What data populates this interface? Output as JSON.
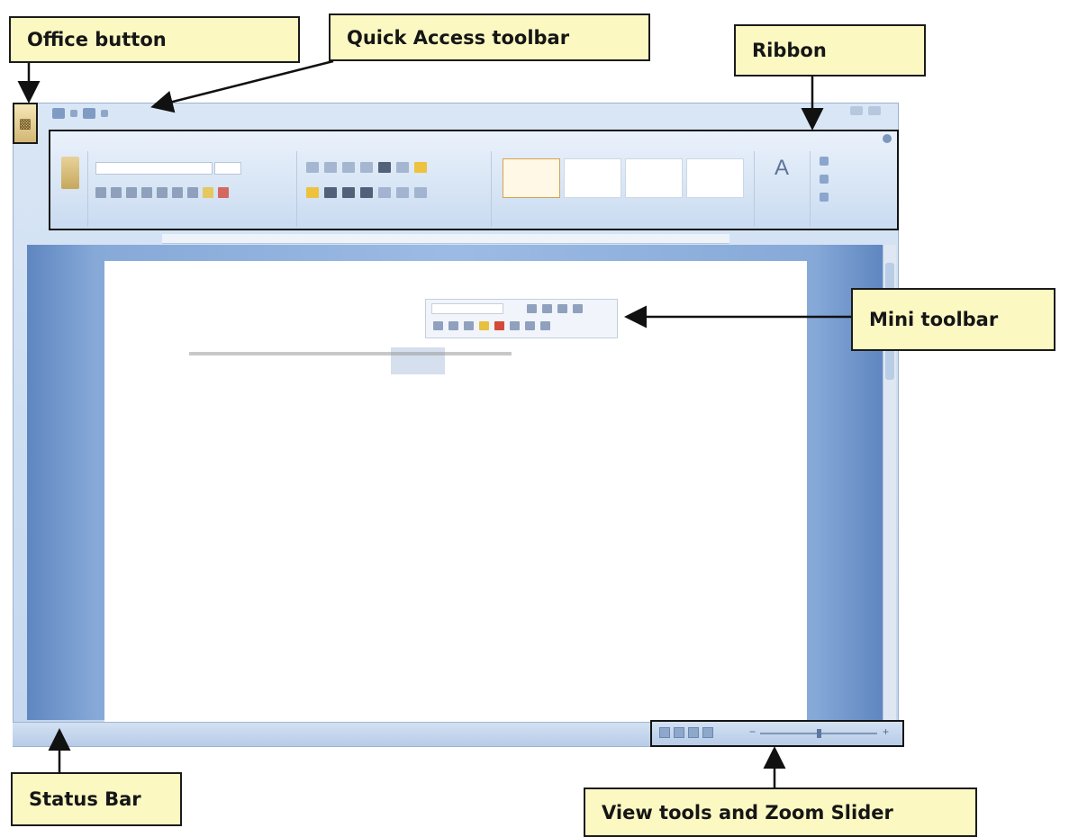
{
  "callouts": {
    "office_button": "Office button",
    "quick_access_toolbar": "Quick Access toolbar",
    "ribbon": "Ribbon",
    "mini_toolbar": "Mini toolbar",
    "status_bar": "Status Bar",
    "view_tools": "View tools and Zoom Slider"
  },
  "colors": {
    "callout_bg": "#fbf8c2",
    "window_blue": "#c3d6ee",
    "doc_frame": "#86a9d8"
  },
  "icons": [
    "office-orb-icon",
    "save-icon",
    "undo-icon",
    "redo-icon",
    "paste-icon",
    "change-styles-icon",
    "zoom-thumb-icon"
  ],
  "zoom": {
    "level_fraction": 0.5
  }
}
